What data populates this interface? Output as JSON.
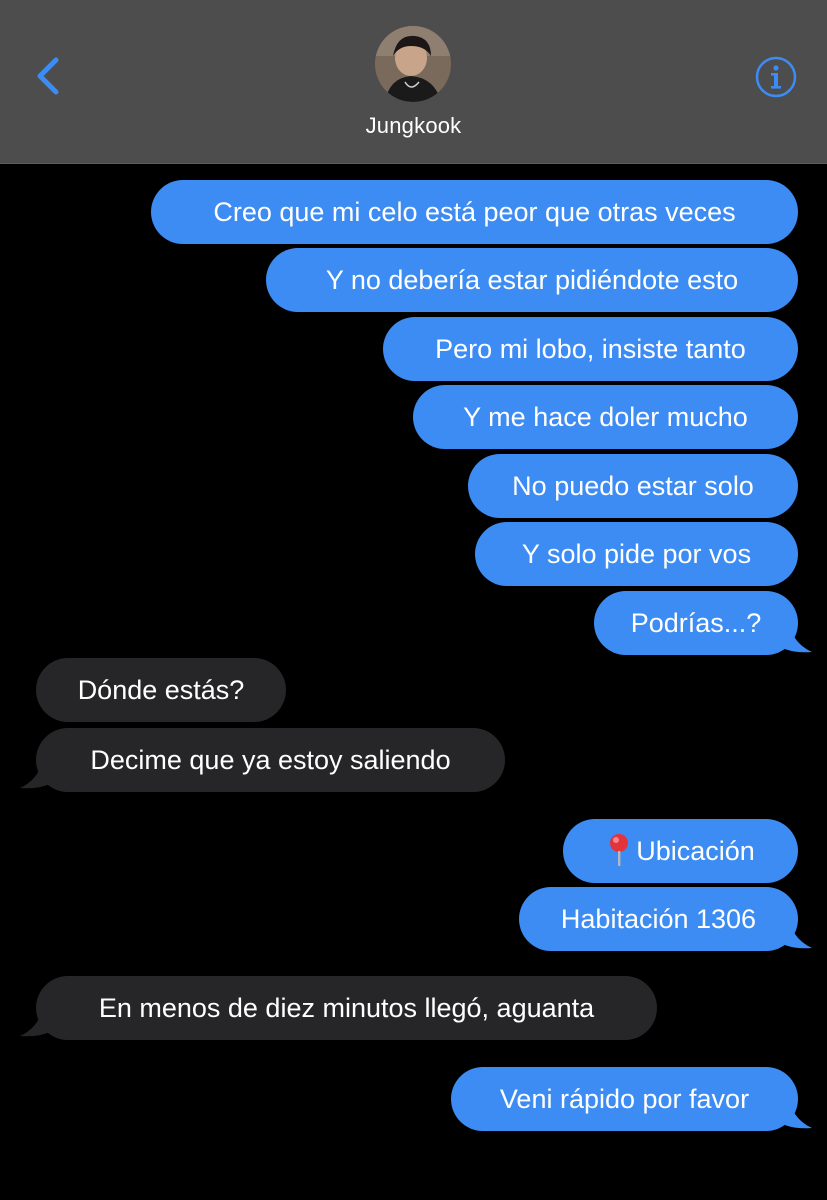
{
  "header": {
    "contact_name": "Jungkook",
    "back_icon": "chevron-left-icon",
    "info_icon": "info-circle-icon",
    "accent_color": "#3c8cf4"
  },
  "messages": [
    {
      "side": "sent",
      "text": "Creo que mi celo está peor que otras veces"
    },
    {
      "side": "sent",
      "text": "Y no debería estar pidiéndote esto"
    },
    {
      "side": "sent",
      "text": "Pero mi lobo, insiste tanto"
    },
    {
      "side": "sent",
      "text": "Y me hace doler mucho"
    },
    {
      "side": "sent",
      "text": "No puedo estar solo"
    },
    {
      "side": "sent",
      "text": "Y solo pide por vos"
    },
    {
      "side": "sent",
      "text": "Podrías...?"
    },
    {
      "side": "received",
      "text": "Dónde estás?"
    },
    {
      "side": "received",
      "text": "Decime que ya estoy saliendo"
    },
    {
      "side": "sent",
      "text": "Ubicación",
      "icon": "pushpin-icon"
    },
    {
      "side": "sent",
      "text": "Habitación 1306"
    },
    {
      "side": "received",
      "text": "En menos de diez minutos llegó, aguanta"
    },
    {
      "side": "sent",
      "text": "Veni rápido por favor"
    }
  ],
  "colors": {
    "sent_bubble": "#3c8cf4",
    "received_bubble": "#262628",
    "header_bg": "#4d4d4d",
    "background": "#000000"
  }
}
